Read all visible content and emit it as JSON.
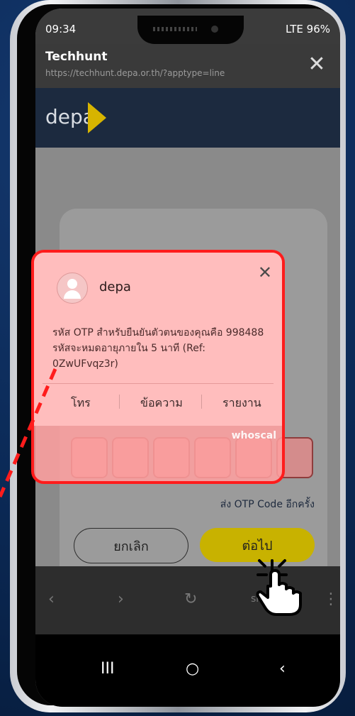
{
  "status": {
    "time": "09:34",
    "battery": "96%",
    "signal": "LTE"
  },
  "browser": {
    "title": "Techhunt",
    "url": "https://techhunt.depa.or.th/?apptype=line",
    "close": "✕"
  },
  "header": {
    "brand": "depa"
  },
  "notification": {
    "sender": "depa",
    "message": "รหัส OTP สำหรับยืนยันตัวตนของคุณคือ 998488 รหัสจะหมดอายุภายใน 5 นาที (Ref: 0ZwUFvqz3r)",
    "actions": [
      "โทร",
      "ข้อความ",
      "รายงาน"
    ],
    "close": "✕"
  },
  "watermark": "whoscal",
  "otp": {
    "boxes": 6
  },
  "resend_label": "ส่ง OTP Code อีกครั้ง",
  "buttons": {
    "cancel": "ยกเลิก",
    "next": "ต่อไป"
  },
  "browser_nav": {
    "back": "‹",
    "forward": "›",
    "reload": "↻",
    "share": "share",
    "menu": "⋮"
  },
  "system_nav": {
    "recent": "III",
    "home": "○",
    "back": "‹"
  }
}
